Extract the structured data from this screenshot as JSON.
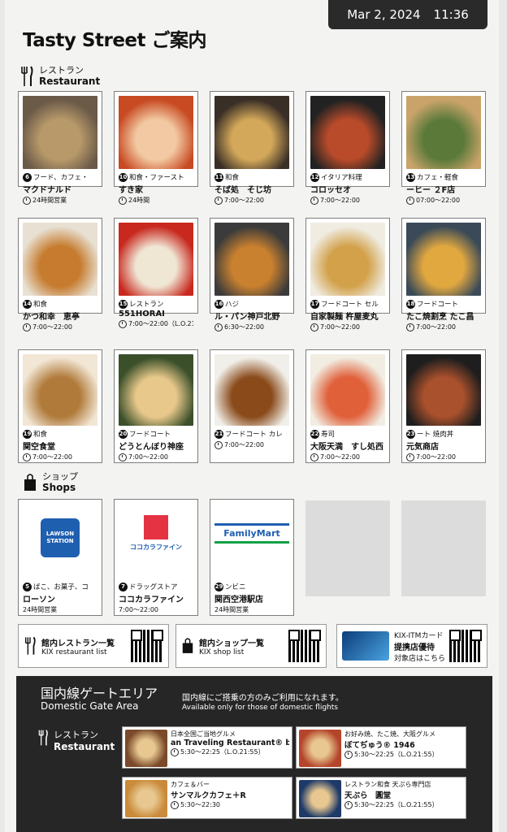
{
  "datetime": {
    "date": "Mar 2, 2024",
    "time": "11:36"
  },
  "title": "Tasty Street ご案内",
  "restaurant_section": {
    "jp": "レストラン",
    "en": "Restaurant"
  },
  "shop_section": {
    "jp": "ショップ",
    "en": "Shops"
  },
  "restaurants": [
    {
      "num": "6",
      "cat": "フード、カフェ・",
      "name": "マクドナルド",
      "hours": "24時間営業"
    },
    {
      "num": "10",
      "cat": "和食・ファースト",
      "name": "すき家",
      "hours": "24時間"
    },
    {
      "num": "11",
      "cat": "和食",
      "name": "そば処　そじ坊",
      "hours": "7:00〜22:00"
    },
    {
      "num": "12",
      "cat": "イタリア料理",
      "name": "コロッセオ",
      "hours": "7:00〜22:00"
    },
    {
      "num": "13",
      "cat": "カフェ・軽食",
      "name": "ーヒー ２F店",
      "hours": "07:00〜22:00"
    },
    {
      "num": "14",
      "cat": "和食",
      "name": "かつ和幸　恵亭",
      "hours": "7:00〜22:00"
    },
    {
      "num": "15",
      "cat": "レストラン",
      "name": "551HORAI",
      "hours": "7:00〜22:00（L.O.21"
    },
    {
      "num": "16",
      "cat": "ハジ",
      "name": "ル・パン神戸北野",
      "hours": "6:30〜22:00"
    },
    {
      "num": "17",
      "cat": "フードコート セル",
      "name": "自家製麺 杵屋麦丸",
      "hours": "7:00〜22:00"
    },
    {
      "num": "18",
      "cat": "フードコート",
      "name": "たこ焼割烹 たこ昌",
      "hours": "7:00〜22:00"
    },
    {
      "num": "19",
      "cat": "和食",
      "name": "関空食堂",
      "hours": "7:00〜22:00"
    },
    {
      "num": "20",
      "cat": "フードコート",
      "name": "どうとんぼり神座",
      "hours": "7:00〜22:00"
    },
    {
      "num": "21",
      "cat": "フードコート カレ",
      "name": "",
      "hours": "7:00〜22:00"
    },
    {
      "num": "22",
      "cat": "寿司",
      "name": "大阪天満　すし処西",
      "hours": "7:00〜22:00"
    },
    {
      "num": "23",
      "cat": "ート 焼肉丼",
      "name": "元気商店",
      "hours": "7:00〜22:00"
    }
  ],
  "shops": [
    {
      "num": "5",
      "cat": "ばこ、お菓子、コ",
      "name": "ローソン",
      "hours": "24時間営業",
      "logo": "LAWSON STATION"
    },
    {
      "num": "7",
      "cat": "ドラッグストア",
      "name": "ココカラファイン",
      "hours": "7:00〜22:00",
      "logo": "ココカラファイン"
    },
    {
      "num": "29",
      "cat": "ンビニ",
      "name": "関西空港駅店",
      "hours": "24時間営業",
      "logo": "FamilyMart"
    }
  ],
  "links": {
    "restaurant_list": {
      "jp": "館内レストラン一覧",
      "en": "KIX restaurant list"
    },
    "shop_list": {
      "jp": "館内ショップ一覧",
      "en": "KIX shop list"
    },
    "card": {
      "l1": "KIX-ITMカード",
      "l2": "提携店優待",
      "l3": "対象店はこちら"
    }
  },
  "domestic": {
    "title_jp": "国内線ゲートエリア",
    "title_en": "Domestic Gate Area",
    "note_jp": "国内線にご搭乗の方のみご利用になれます。",
    "note_en": "Available only for those of domestic flights",
    "section_jp": "レストラン",
    "section_en": "Restaurant",
    "cards": [
      {
        "cat": "日本全国ご当地グルメ",
        "name": "an Traveling Restaurant® by BC",
        "hours": "5:30〜22:25（L.O.21:55）"
      },
      {
        "cat": "お好み焼、たこ焼、大阪グルメ",
        "name": "ぼてぢゅう® 1946",
        "hours": "5:30〜22:25（L.O.21:55）"
      },
      {
        "cat": "カフェ＆バー",
        "name": "サンマルクカフェ＋R",
        "hours": "5:30〜22:30"
      },
      {
        "cat": "レストラン和食 天ぷら専門店",
        "name": "天ぷら　圓堂",
        "hours": "5:30〜22:25（L.O.21:55）"
      }
    ]
  },
  "colors": {
    "dark": "#262626",
    "accent_red": "#e53344",
    "lawson_blue": "#1f5fb0",
    "famima_green": "#11a146"
  }
}
